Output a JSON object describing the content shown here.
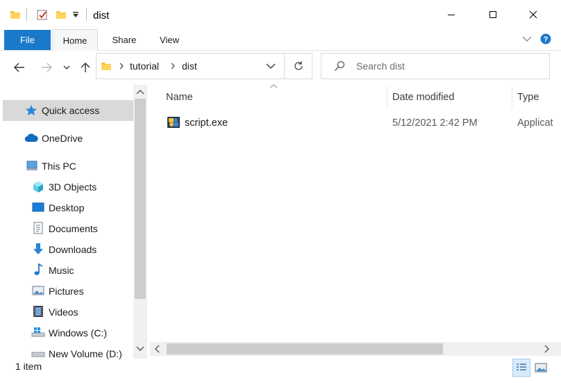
{
  "window": {
    "title": "dist"
  },
  "ribbon": {
    "tabs": [
      {
        "label": "File"
      },
      {
        "label": "Home"
      },
      {
        "label": "Share"
      },
      {
        "label": "View"
      }
    ]
  },
  "address": {
    "breadcrumbs": [
      {
        "label": "tutorial"
      },
      {
        "label": "dist"
      }
    ]
  },
  "search": {
    "placeholder": "Search dist"
  },
  "sidebar": {
    "items": [
      {
        "label": "Quick access",
        "icon": "star-icon",
        "selected": true
      },
      {
        "label": "OneDrive",
        "icon": "cloud-icon"
      },
      {
        "label": "This PC",
        "icon": "computer-icon"
      },
      {
        "label": "3D Objects",
        "icon": "cube-icon"
      },
      {
        "label": "Desktop",
        "icon": "desktop-icon"
      },
      {
        "label": "Documents",
        "icon": "document-icon"
      },
      {
        "label": "Downloads",
        "icon": "download-icon"
      },
      {
        "label": "Music",
        "icon": "music-icon"
      },
      {
        "label": "Pictures",
        "icon": "picture-icon"
      },
      {
        "label": "Videos",
        "icon": "video-icon"
      },
      {
        "label": "Windows (C:)",
        "icon": "drive-icon"
      },
      {
        "label": "New Volume (D:)",
        "icon": "drive-icon"
      }
    ]
  },
  "columns": [
    {
      "label": "Name"
    },
    {
      "label": "Date modified"
    },
    {
      "label": "Type"
    }
  ],
  "files": [
    {
      "name": "script.exe",
      "date_modified": "5/12/2021 2:42 PM",
      "type": "Applicat"
    }
  ],
  "status": {
    "item_count": "1 item"
  },
  "colors": {
    "accent": "#1979ca",
    "selection": "#d9d9d9",
    "folder": "#f8c442"
  }
}
